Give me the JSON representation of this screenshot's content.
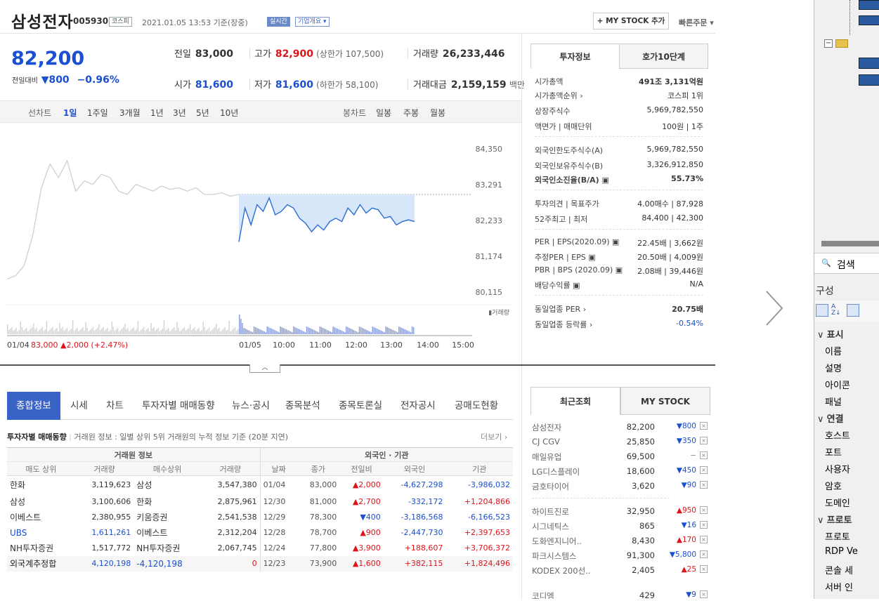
{
  "header": {
    "stock_name": "삼성전자",
    "stock_code": "005930",
    "market_tag": "코스피",
    "timestamp": "2021.01.05 13:53 기준(장중)",
    "realtime_tag": "실시간",
    "company_tag": "기업개요 ▾",
    "mystock_button": "+ MY STOCK 추가",
    "quick_order": "빠른주문 ▾"
  },
  "price": {
    "current": "82,200",
    "change_label": "전일대비",
    "change": "▼800",
    "change_pct": "−0.96%",
    "prev_label": "전일",
    "prev": "83,000",
    "high_label": "고가",
    "high": "82,900",
    "upper_limit": "(상한가 107,500)",
    "volume_label": "거래량",
    "volume": "26,233,446",
    "open_label": "시가",
    "open": "81,600",
    "low_label": "저가",
    "low": "81,600",
    "lower_limit": "(하한가 58,100)",
    "amount_label": "거래대금",
    "amount": "2,159,159",
    "amount_unit": "백만"
  },
  "timeframe": {
    "line_label": "선차트",
    "line_items": [
      "1일",
      "1주일",
      "3개월",
      "1년",
      "3년",
      "5년",
      "10년"
    ],
    "candle_label": "봉차트",
    "candle_items": [
      "일봉",
      "주봉",
      "월봉"
    ]
  },
  "chart_data": {
    "type": "line",
    "y_ticks": [
      "84,350",
      "83,291",
      "82,233",
      "81,174",
      "80,115"
    ],
    "x_ticks": [
      "01/05",
      "10:00",
      "11:00",
      "12:00",
      "13:00",
      "14:00",
      "15:00"
    ],
    "prev_day_label": "01/04",
    "prev_day_close": "83,000",
    "prev_day_change": "▲2,000 (+2.47%)",
    "volume_label": "거래량",
    "ylim": [
      80115,
      84350
    ],
    "prev_day_series": [
      80500,
      80600,
      80900,
      81800,
      83200,
      83900,
      83500,
      84000,
      83100,
      83400,
      83300,
      83600,
      83500,
      83100,
      83000,
      83300,
      83200,
      83100,
      83250,
      83150,
      83200,
      83100,
      83200,
      83000,
      83000,
      83050,
      82950,
      83000
    ],
    "today_series": [
      81600,
      82600,
      82100,
      82700,
      82500,
      82900,
      82400,
      82500,
      82700,
      82600,
      82300,
      82150,
      81900,
      82100,
      81950,
      82200,
      82300,
      82200,
      82600,
      82400,
      82700,
      82450,
      82600,
      82550,
      82300,
      82350,
      82100,
      82200,
      82250,
      82200
    ],
    "reference_price": 83000
  },
  "info_panel": {
    "tab_active": "투자정보",
    "tab_other": "호가10단계",
    "rows": [
      {
        "k": "시가총액",
        "v": "491조 3,131억원"
      },
      {
        "k": "시가총액순위 ›",
        "v": "코스피 1위"
      },
      {
        "k": "상장주식수",
        "v": "5,969,782,550"
      },
      {
        "k": "액면가 | 매매단위",
        "v": "100원 | 1주"
      },
      {
        "k": "외국인한도주식수(A)",
        "v": "5,969,782,550"
      },
      {
        "k": "외국인보유주식수(B)",
        "v": "3,326,912,850"
      },
      {
        "k": "외국인소진율(B/A) ▣",
        "v": "55.73%"
      },
      {
        "k": "투자의견 | 목표주가",
        "v": "4.00매수 | 87,928"
      },
      {
        "k": "52주최고 | 최저",
        "v": "84,400 | 42,300"
      },
      {
        "k": "PER | EPS(2020.09) ▣",
        "v": "22.45배 | 3,662원"
      },
      {
        "k": "추정PER | EPS ▣",
        "v": "20.50배 | 4,009원"
      },
      {
        "k": "PBR | BPS (2020.09) ▣",
        "v": "2.08배 | 39,446원"
      },
      {
        "k": "배당수익률 ▣",
        "v": "N/A"
      },
      {
        "k": "동일업종 PER ›",
        "v": "20.75배"
      },
      {
        "k": "동일업종 등락률 ›",
        "v": "-0.54%"
      }
    ]
  },
  "tabs": [
    "종합정보",
    "시세",
    "차트",
    "투자자별 매매동향",
    "뉴스·공시",
    "종목분석",
    "종목토론실",
    "전자공시",
    "공매도현황"
  ],
  "trade": {
    "title": "투자자별 매매동향",
    "desc": "거래원 정보 : 일별 상위 5위 거래원의 누적 정보 기준 (20분 지연)",
    "more": "더보기 ›",
    "group_left": "거래원 정보",
    "group_right": "외국인 · 기관",
    "headers": [
      "매도 상위",
      "거래량",
      "매수상위",
      "거래량",
      "날짜",
      "종가",
      "전일비",
      "외국인",
      "기관"
    ],
    "rows": [
      [
        "한화",
        "3,119,623",
        "삼성",
        "3,547,380",
        "01/04",
        "83,000",
        "▲2,000",
        "-4,627,298",
        "-3,986,032"
      ],
      [
        "삼성",
        "3,100,606",
        "한화",
        "2,875,961",
        "12/30",
        "81,000",
        "▲2,700",
        "-332,172",
        "+1,204,866"
      ],
      [
        "이베스트",
        "2,380,955",
        "키움증권",
        "2,541,538",
        "12/29",
        "78,300",
        "▼400",
        "-3,186,568",
        "-6,166,523"
      ],
      [
        "UBS",
        "1,611,261",
        "이베스트",
        "2,312,204",
        "12/28",
        "78,700",
        "▲900",
        "-2,447,730",
        "+2,397,653"
      ],
      [
        "NH투자증권",
        "1,517,772",
        "NH투자증권",
        "2,067,745",
        "12/24",
        "77,800",
        "▲3,900",
        "+188,607",
        "+3,706,372"
      ],
      [
        "외국계추정합",
        "4,120,198",
        "-4,120,198",
        "0",
        "12/23",
        "73,900",
        "▲1,600",
        "+382,115",
        "+1,824,496"
      ]
    ]
  },
  "recent": {
    "tab_active": "최근조회",
    "tab_other": "MY STOCK",
    "rows": [
      [
        "삼성전자",
        "82,200",
        "▼800"
      ],
      [
        "CJ CGV",
        "25,850",
        "▼350"
      ],
      [
        "매일유업",
        "69,500",
        "−"
      ],
      [
        "LG디스플레이",
        "18,600",
        "▼450"
      ],
      [
        "금호타이어",
        "3,620",
        "▼90"
      ],
      [
        "하이트진로",
        "32,950",
        "▲950"
      ],
      [
        "시그네틱스",
        "865",
        "▼16"
      ],
      [
        "도화엔지니어..",
        "8,430",
        "▲170"
      ],
      [
        "파크시스템스",
        "91,300",
        "▼5,800"
      ],
      [
        "KODEX 200선..",
        "2,405",
        "▲25"
      ],
      [
        "코디엠",
        "429",
        "▼9"
      ]
    ],
    "close": "×"
  },
  "side_panel": {
    "search": "검색",
    "group": "구성",
    "categories": [
      {
        "name": "표시",
        "items": [
          "이름",
          "설명",
          "아이콘",
          "패널"
        ]
      },
      {
        "name": "연결",
        "items": [
          "호스트",
          "포트",
          "사용자",
          "암호",
          "도메인"
        ]
      },
      {
        "name": "프로토",
        "items": [
          "프로토",
          "RDP Ve",
          "콘솔 세",
          "서버 인"
        ]
      }
    ]
  },
  "colors": {
    "up": "#e0131a",
    "down": "#1a4fd1",
    "tab": "#3a63c7"
  }
}
